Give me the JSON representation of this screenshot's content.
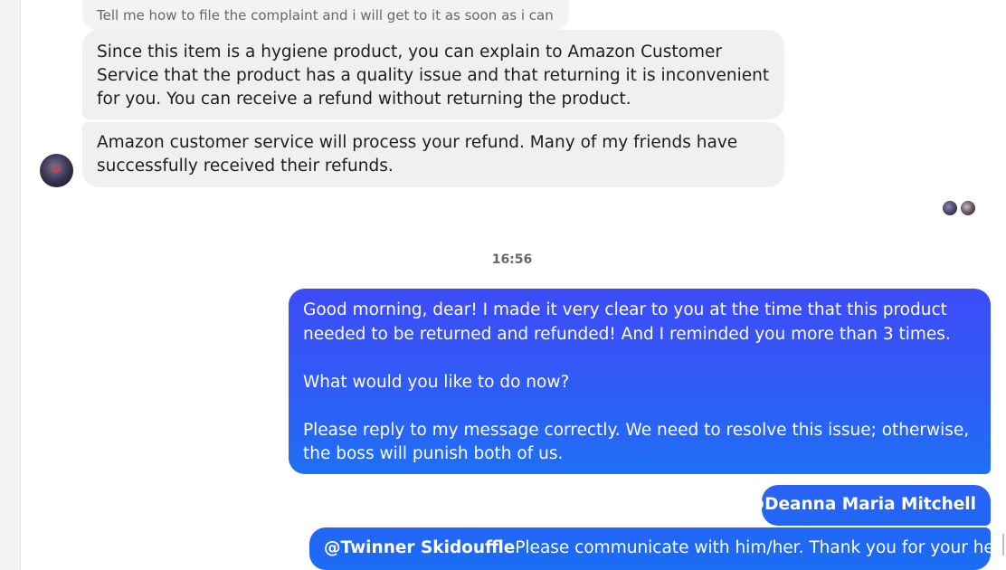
{
  "conversation": {
    "quoted_message": "Tell me how to file the complaint and i will get to it as soon as i can",
    "incoming": [
      {
        "text": "Since this item is a hygiene product, you can explain to Amazon Customer Service that the product has a quality issue and that returning it is inconvenient for you. You can receive a refund without returning the product."
      },
      {
        "text": "Amazon customer service will process your refund. Many of my friends have successfully received their refunds."
      }
    ],
    "timestamp": "16:56",
    "outgoing": {
      "paragraphs": [
        "Good morning, dear! I made it very clear to you at the time that this product needed to be returned and refunded! And I reminded you more than 3 times.",
        "What would you like to do now?",
        "Please reply to my message correctly. We need to resolve this issue; otherwise, the boss will punish both of us."
      ],
      "mention_1": "@Deanna Maria Mitchell",
      "mention_2": "@Twinner Skidouffle",
      "mention_2_text": "Please communicate with him/her. Thank you for your help."
    }
  },
  "colors": {
    "incoming_bubble": "#f0f0f0",
    "outgoing_bubble": "#2f5cf6",
    "timestamp_text": "#65676b"
  }
}
